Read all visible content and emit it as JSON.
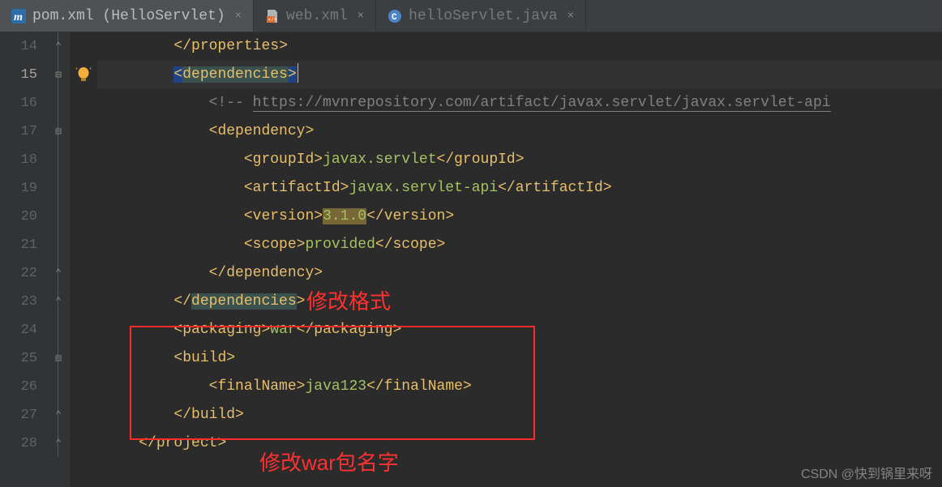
{
  "tabs": [
    {
      "label": "pom.xml (HelloServlet)",
      "icon": "maven",
      "active": true
    },
    {
      "label": "web.xml",
      "icon": "xml",
      "active": false
    },
    {
      "label": "helloServlet.java",
      "icon": "java-class",
      "active": false
    }
  ],
  "gutter": {
    "start": 14,
    "end": 28
  },
  "code": {
    "line14": {
      "indent": "        ",
      "open": "</",
      "tag": "properties",
      "close": ">"
    },
    "line15": {
      "indent": "        ",
      "open": "<",
      "tag": "dependencies",
      "close": ">"
    },
    "line16": {
      "indent": "            ",
      "comment_prefix": "<!-- ",
      "comment_url": "https://mvnrepository.com/artifact/javax.servlet/javax.servlet-api"
    },
    "line17": {
      "indent": "            ",
      "open": "<",
      "tag": "dependency",
      "close": ">"
    },
    "line18": {
      "indent": "                ",
      "open": "<",
      "tag": "groupId",
      "close": ">",
      "value": "javax.servlet",
      "open2": "</",
      "tag2": "groupId",
      "close2": ">"
    },
    "line19": {
      "indent": "                ",
      "open": "<",
      "tag": "artifactId",
      "close": ">",
      "value": "javax.servlet-api",
      "open2": "</",
      "tag2": "artifactId",
      "close2": ">"
    },
    "line20": {
      "indent": "                ",
      "open": "<",
      "tag": "version",
      "close": ">",
      "value": "3.1.0",
      "open2": "</",
      "tag2": "version",
      "close2": ">"
    },
    "line21": {
      "indent": "                ",
      "open": "<",
      "tag": "scope",
      "close": ">",
      "value": "provided",
      "open2": "</",
      "tag2": "scope",
      "close2": ">"
    },
    "line22": {
      "indent": "            ",
      "open": "</",
      "tag": "dependency",
      "close": ">"
    },
    "line23": {
      "indent": "        ",
      "open": "</",
      "tag": "dependencies",
      "close": ">"
    },
    "line24": {
      "indent": "        ",
      "open": "<",
      "tag": "packaging",
      "close": ">",
      "value": "war",
      "open2": "</",
      "tag2": "packaging",
      "close2": ">"
    },
    "line25": {
      "indent": "        ",
      "open": "<",
      "tag": "build",
      "close": ">"
    },
    "line26": {
      "indent": "            ",
      "open": "<",
      "tag": "finalName",
      "close": ">",
      "value": "java123",
      "open2": "</",
      "tag2": "finalName",
      "close2": ">"
    },
    "line27": {
      "indent": "        ",
      "open": "</",
      "tag": "build",
      "close": ">"
    },
    "line28": {
      "indent": "    ",
      "open": "</",
      "tag": "project",
      "close": ">"
    }
  },
  "annotations": {
    "label1": "修改格式",
    "label2": "修改war包名字"
  },
  "watermark": "CSDN @快到锅里来呀"
}
